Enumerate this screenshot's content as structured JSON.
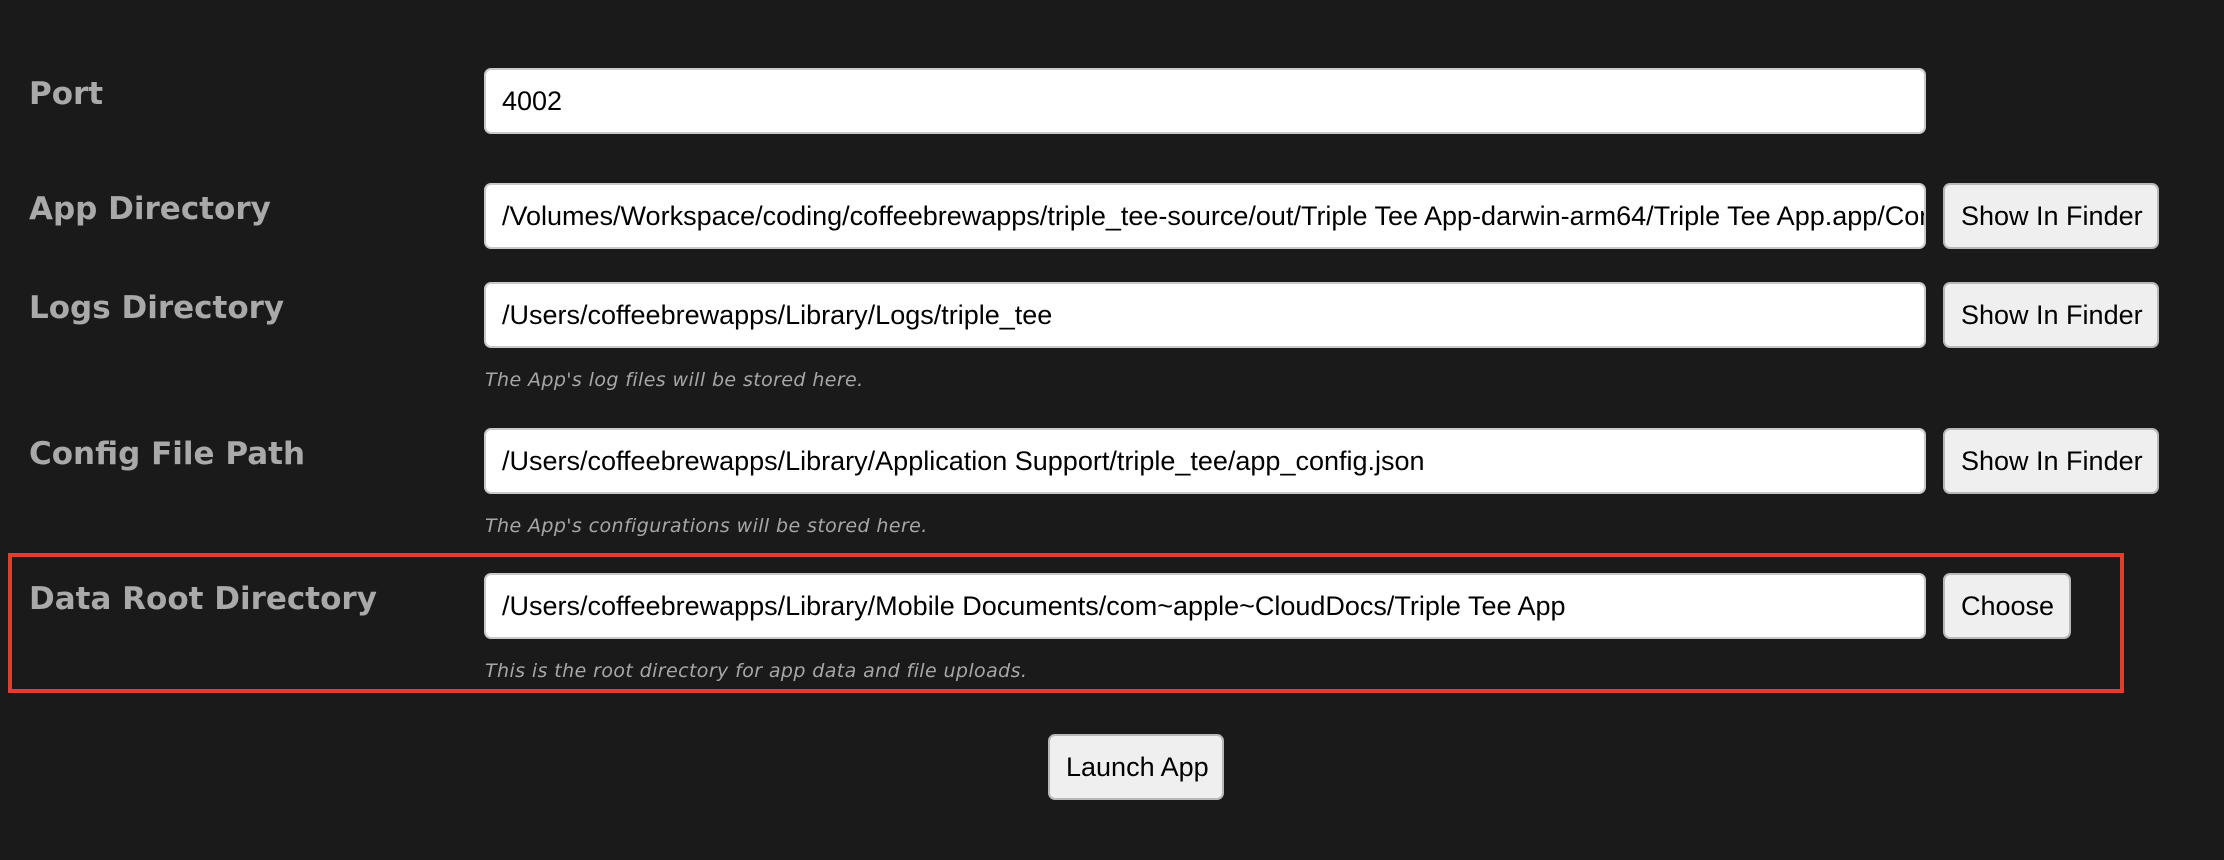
{
  "settings": {
    "port": {
      "label": "Port",
      "value": "4002"
    },
    "app_directory": {
      "label": "App Directory",
      "value": "/Volumes/Workspace/coding/coffeebrewapps/triple_tee-source/out/Triple Tee App-darwin-arm64/Triple Tee App.app/Contents/Resources/app",
      "button": "Show In Finder"
    },
    "logs_directory": {
      "label": "Logs Directory",
      "value": "/Users/coffeebrewapps/Library/Logs/triple_tee",
      "button": "Show In Finder",
      "hint": "The App's log files will be stored here."
    },
    "config_file_path": {
      "label": "Config File Path",
      "value": "/Users/coffeebrewapps/Library/Application Support/triple_tee/app_config.json",
      "button": "Show In Finder",
      "hint": "The App's configurations will be stored here."
    },
    "data_root_directory": {
      "label": "Data Root Directory",
      "value": "/Users/coffeebrewapps/Library/Mobile Documents/com~apple~CloudDocs/Triple Tee App",
      "button": "Choose",
      "hint": "This is the root directory for app data and file uploads."
    }
  },
  "launch_button": "Launch App",
  "colors": {
    "background": "#1a1a1a",
    "label": "#a9a9a9",
    "hint": "#a7a7a7",
    "highlight_border": "#e0402a"
  }
}
